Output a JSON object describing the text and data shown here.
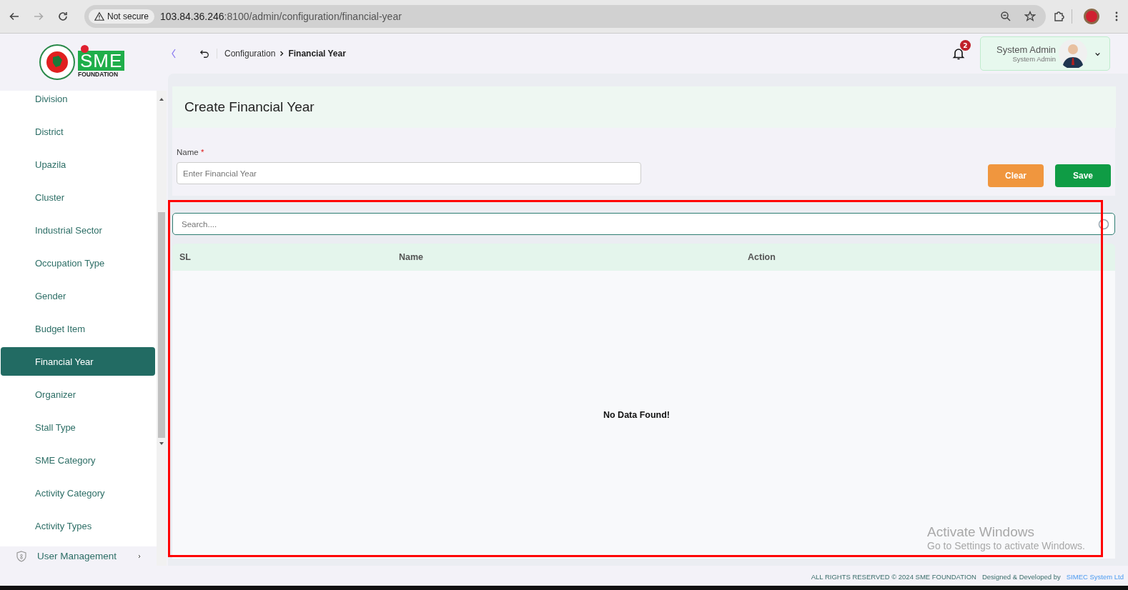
{
  "browser": {
    "security": "Not secure",
    "url_host": "103.84.36.246",
    "url_rest": ":8100/admin/configuration/financial-year"
  },
  "logo": {
    "text": "SME",
    "subtitle": "FOUNDATION"
  },
  "breadcrumb": [
    {
      "label": "Configuration",
      "current": false
    },
    {
      "label": "Financial Year",
      "current": true
    }
  ],
  "notifications": {
    "count": "2"
  },
  "user": {
    "name": "System Admin",
    "role": "System Admin"
  },
  "sidebar": {
    "items": [
      {
        "label": "Division",
        "selected": false
      },
      {
        "label": "District",
        "selected": false
      },
      {
        "label": "Upazila",
        "selected": false
      },
      {
        "label": "Cluster",
        "selected": false
      },
      {
        "label": "Industrial Sector",
        "selected": false
      },
      {
        "label": "Occupation Type",
        "selected": false
      },
      {
        "label": "Gender",
        "selected": false
      },
      {
        "label": "Budget Item",
        "selected": false
      },
      {
        "label": "Financial Year",
        "selected": true
      },
      {
        "label": "Organizer",
        "selected": false
      },
      {
        "label": "Stall Type",
        "selected": false
      },
      {
        "label": "SME Category",
        "selected": false
      },
      {
        "label": "Activity Category",
        "selected": false
      },
      {
        "label": "Activity Types",
        "selected": false
      }
    ],
    "section": {
      "label": "User Management",
      "expanded": false
    }
  },
  "page_title": "Create Financial Year",
  "form": {
    "label": "Name",
    "required_mark": "*",
    "placeholder": "Enter Financial Year",
    "buttons": [
      {
        "label": "Clear",
        "kind": "clear"
      },
      {
        "label": "Save",
        "kind": "save"
      }
    ]
  },
  "search": {
    "placeholder": "Search...."
  },
  "table": {
    "columns": [
      "SL",
      "Name",
      "Action"
    ],
    "empty_text": "No Data Found!"
  },
  "os_notice": {
    "title": "Activate Windows",
    "text": "Go to Settings to activate Windows."
  },
  "footer": {
    "copyright": "ALL RIGHTS RESERVED © 2024 SME FOUNDATION",
    "credit": "Designed & Developed by",
    "company": "SIMEC System Ltd"
  }
}
